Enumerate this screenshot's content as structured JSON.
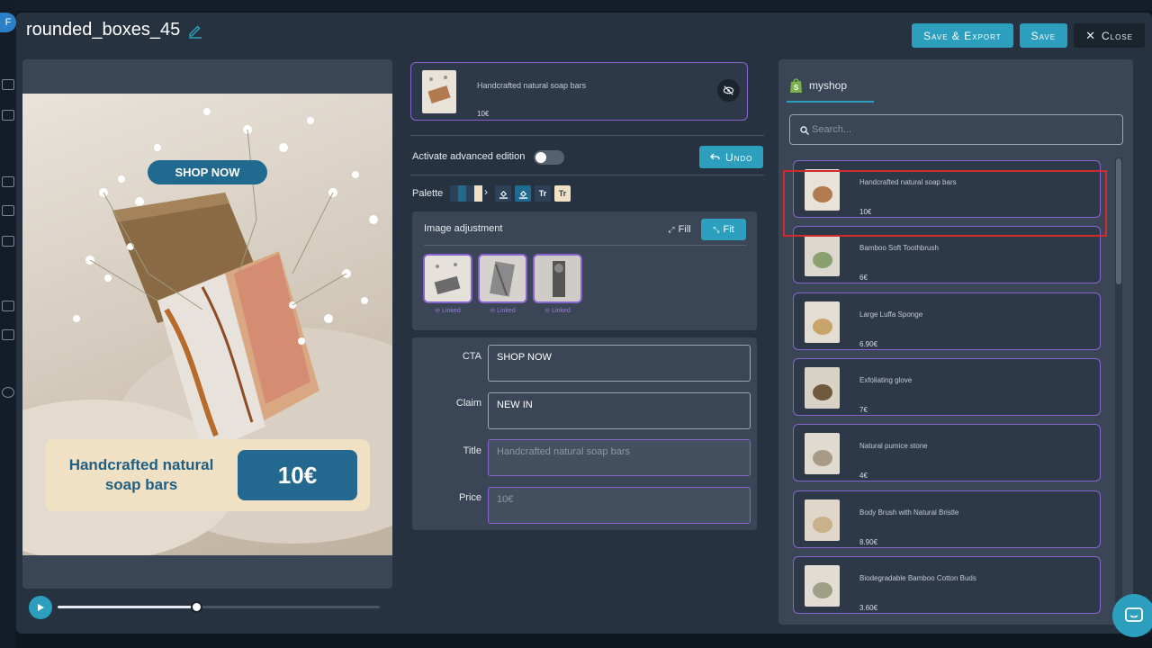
{
  "background": {
    "avatar_letter": "F"
  },
  "header": {
    "title": "rounded_boxes_45",
    "save_export": "Save & Export",
    "save": "Save",
    "close": "Close"
  },
  "preview": {
    "cta": "SHOP NOW",
    "title": "Handcrafted natural soap bars",
    "price": "10€",
    "progress": 0.43
  },
  "selected_product": {
    "name": "Handcrafted natural soap bars",
    "price": "10€"
  },
  "controls": {
    "advanced_label": "Activate advanced edition",
    "advanced_on": false,
    "undo": "Undo",
    "palette_label": "Palette",
    "palette_colors": [
      "#2d4258",
      "#1f6a8e",
      "#f0e1c4"
    ],
    "palette_font_btn": "Tr"
  },
  "image_adjustment": {
    "title": "Image adjustment",
    "fill": "Fill",
    "fit": "Fit",
    "selected_mode": "Fit",
    "images": [
      {
        "linked_label": "Linked"
      },
      {
        "linked_label": "Linked"
      },
      {
        "linked_label": "Linked"
      }
    ]
  },
  "fields": [
    {
      "label": "CTA",
      "value": "SHOP NOW",
      "placeholder": ""
    },
    {
      "label": "Claim",
      "value": "NEW IN",
      "placeholder": ""
    },
    {
      "label": "Title",
      "value": "",
      "placeholder": "Handcrafted natural soap bars"
    },
    {
      "label": "Price",
      "value": "",
      "placeholder": "10€"
    }
  ],
  "shop": {
    "tab": "myshop",
    "search_placeholder": "Search...",
    "products": [
      {
        "name": "Handcrafted natural soap bars",
        "price": "10€"
      },
      {
        "name": "Bamboo Soft Toothbrush",
        "price": "6€"
      },
      {
        "name": "Large Luffa Sponge",
        "price": "6.90€"
      },
      {
        "name": "Exfoliating glove",
        "price": "7€"
      },
      {
        "name": "Natural pumice stone",
        "price": "4€"
      },
      {
        "name": "Body Brush with Natural Bristle",
        "price": "8.90€"
      },
      {
        "name": "Biodegradable Bamboo Cotton Buds",
        "price": "3.60€"
      }
    ]
  },
  "colors": {
    "accent": "#2b9fbd",
    "panel": "#3a4655",
    "modal": "#273240",
    "purple_border": "#8a63d2",
    "highlight_red": "#d12b2b"
  }
}
